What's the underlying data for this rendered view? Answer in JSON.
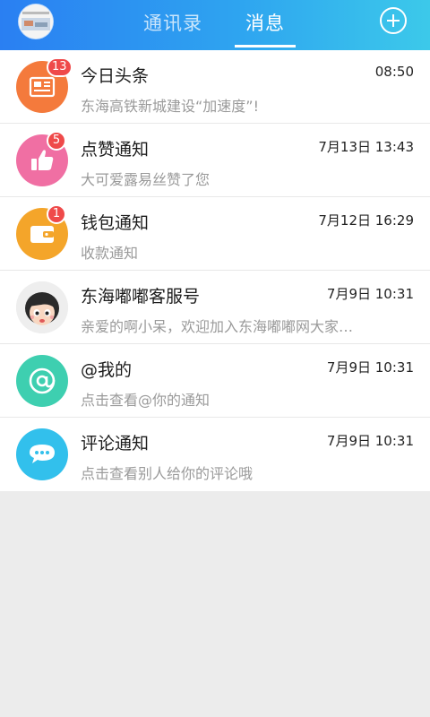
{
  "header": {
    "tabs": [
      {
        "label": "通讯录",
        "active": false
      },
      {
        "label": "消息",
        "active": true
      }
    ],
    "add_icon": "plus-circle-icon",
    "profile_avatar_icon": "profile-avatar-icon"
  },
  "colors": {
    "header_gradient_start": "#2a7ff2",
    "header_gradient_end": "#3cc9ea",
    "badge": "#ef4a4a",
    "background": "#ececec"
  },
  "messages": [
    {
      "title": "今日头条",
      "time": "08:50",
      "subtitle": "东海高铁新城建设“加速度”!",
      "badge": "13",
      "icon": "newspaper-icon",
      "icon_color": "#f47a3c"
    },
    {
      "title": "点赞通知",
      "time": "7月13日 13:43",
      "subtitle": "大可爱露易丝赞了您",
      "badge": "5",
      "icon": "thumbs-up-icon",
      "icon_color": "#f06fa3"
    },
    {
      "title": "钱包通知",
      "time": "7月12日 16:29",
      "subtitle": "收款通知",
      "badge": "1",
      "icon": "wallet-icon",
      "icon_color": "#f4a52a"
    },
    {
      "title": "东海嘟嘟客服号",
      "time": "7月9日 10:31",
      "subtitle": "亲爱的啊小呆，欢迎加入东海嘟嘟网大家…",
      "badge": "",
      "icon": "cartoon-avatar-icon",
      "icon_color": "#f2f2f2"
    },
    {
      "title": "@我的",
      "time": "7月9日 10:31",
      "subtitle": "点击查看@你的通知",
      "badge": "",
      "icon": "at-sign-icon",
      "icon_color": "#3ecfb0"
    },
    {
      "title": "评论通知",
      "time": "7月9日 10:31",
      "subtitle": "点击查看别人给你的评论哦",
      "badge": "",
      "icon": "comment-bubble-icon",
      "icon_color": "#32c0ec"
    }
  ]
}
